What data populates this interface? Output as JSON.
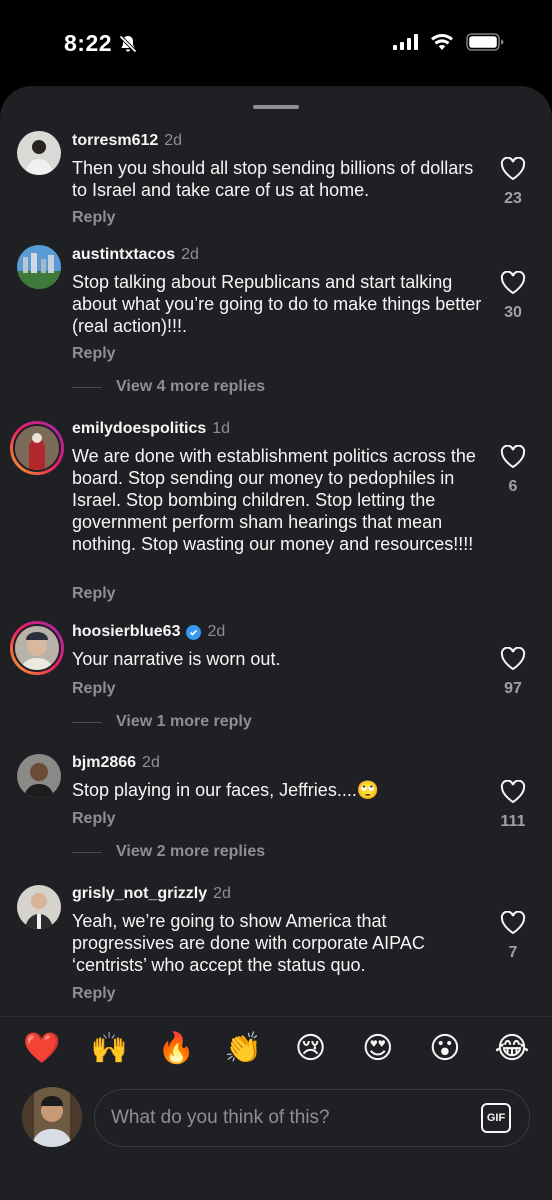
{
  "status": {
    "time": "8:22"
  },
  "comments": [
    {
      "username": "torresm612",
      "time": "2d",
      "text": "Then you should all stop sending billions of dollars to Israel and take care of us at home.",
      "reply": "Reply",
      "likes": "23"
    },
    {
      "username": "austintxtacos",
      "time": "2d",
      "text": "Stop talking about Republicans and start talking about what you’re going to do to make things better (real action)!!!.",
      "reply": "Reply",
      "likes": "30",
      "more_replies": "View 4 more replies"
    },
    {
      "username": "emilydoespolitics",
      "time": "1d",
      "text": "We are done with establishment politics across the board. Stop sending our money to pedophiles in Israel. Stop bombing children. Stop letting the government perform sham hearings that mean nothing. Stop wasting our money and resources!!!!",
      "reply": "Reply",
      "likes": "6"
    },
    {
      "username": "hoosierblue63",
      "time": "2d",
      "text": "Your narrative is worn out.",
      "reply": "Reply",
      "likes": "97",
      "more_replies": "View 1 more reply"
    },
    {
      "username": "bjm2866",
      "time": "2d",
      "text": "Stop playing in our faces, Jeffries....🙄",
      "reply": "Reply",
      "likes": "111",
      "more_replies": "View 2 more replies"
    },
    {
      "username": "grisly_not_grizzly",
      "time": "2d",
      "text": "Yeah, we’re going to show America that progressives are done with corporate AIPAC ‘centrists’ who accept the status quo.",
      "reply": "Reply",
      "likes": "7"
    }
  ],
  "emojis": [
    "❤️",
    "🙌",
    "🔥",
    "👏",
    "😢",
    "😍",
    "😮",
    "😂"
  ],
  "composer": {
    "placeholder": "What do you think of this?",
    "gif_label": "GIF"
  },
  "colors": {
    "background": "#1f2024",
    "text": "#f5f5f5",
    "secondary": "#8e8e93",
    "verified": "#3897f0"
  }
}
